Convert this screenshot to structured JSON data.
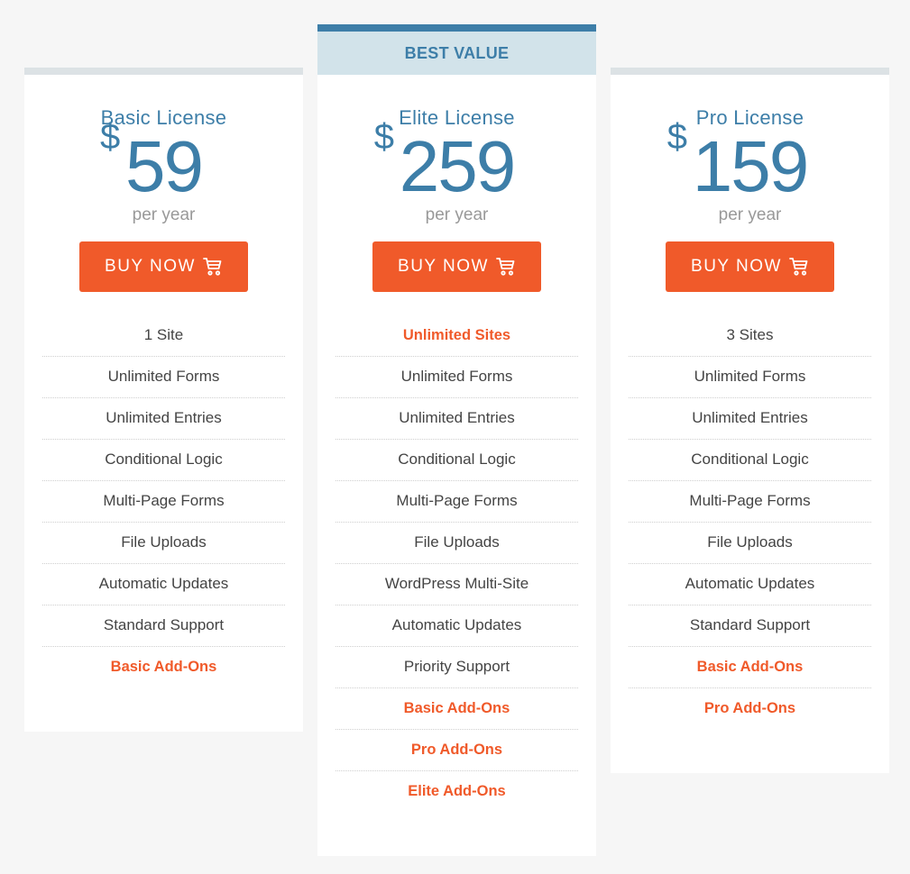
{
  "colors": {
    "background": "#f6f6f6",
    "accent_blue": "#3d7ea8",
    "banner_bg": "#d2e3ea",
    "accent_orange": "#f05a2a",
    "muted_text": "#999999",
    "body_text": "#444444"
  },
  "plans": [
    {
      "name": "Basic License",
      "currency": "$",
      "price": "59",
      "period": "per year",
      "button_label": "BUY NOW",
      "button_icon": "cart-icon",
      "features": [
        {
          "label": "1 Site",
          "highlight": false
        },
        {
          "label": "Unlimited Forms",
          "highlight": false
        },
        {
          "label": "Unlimited Entries",
          "highlight": false
        },
        {
          "label": "Conditional Logic",
          "highlight": false
        },
        {
          "label": "Multi-Page Forms",
          "highlight": false
        },
        {
          "label": "File Uploads",
          "highlight": false
        },
        {
          "label": "Automatic Updates",
          "highlight": false
        },
        {
          "label": "Standard Support",
          "highlight": false
        },
        {
          "label": "Basic Add-Ons",
          "highlight": true
        }
      ]
    },
    {
      "name": "Elite License",
      "banner": "BEST VALUE",
      "currency": "$",
      "price": "259",
      "period": "per year",
      "button_label": "BUY NOW",
      "button_icon": "cart-icon",
      "features": [
        {
          "label": "Unlimited Sites",
          "highlight": true
        },
        {
          "label": "Unlimited Forms",
          "highlight": false
        },
        {
          "label": "Unlimited Entries",
          "highlight": false
        },
        {
          "label": "Conditional Logic",
          "highlight": false
        },
        {
          "label": "Multi-Page Forms",
          "highlight": false
        },
        {
          "label": "File Uploads",
          "highlight": false
        },
        {
          "label": "WordPress Multi-Site",
          "highlight": false
        },
        {
          "label": "Automatic Updates",
          "highlight": false
        },
        {
          "label": "Priority Support",
          "highlight": false
        },
        {
          "label": "Basic Add-Ons",
          "highlight": true
        },
        {
          "label": "Pro Add-Ons",
          "highlight": true
        },
        {
          "label": "Elite Add-Ons",
          "highlight": true
        }
      ]
    },
    {
      "name": "Pro License",
      "currency": "$",
      "price": "159",
      "period": "per year",
      "button_label": "BUY NOW",
      "button_icon": "cart-icon",
      "features": [
        {
          "label": "3 Sites",
          "highlight": false
        },
        {
          "label": "Unlimited Forms",
          "highlight": false
        },
        {
          "label": "Unlimited Entries",
          "highlight": false
        },
        {
          "label": "Conditional Logic",
          "highlight": false
        },
        {
          "label": "Multi-Page Forms",
          "highlight": false
        },
        {
          "label": "File Uploads",
          "highlight": false
        },
        {
          "label": "Automatic Updates",
          "highlight": false
        },
        {
          "label": "Standard Support",
          "highlight": false
        },
        {
          "label": "Basic Add-Ons",
          "highlight": true
        },
        {
          "label": "Pro Add-Ons",
          "highlight": true
        }
      ]
    }
  ]
}
